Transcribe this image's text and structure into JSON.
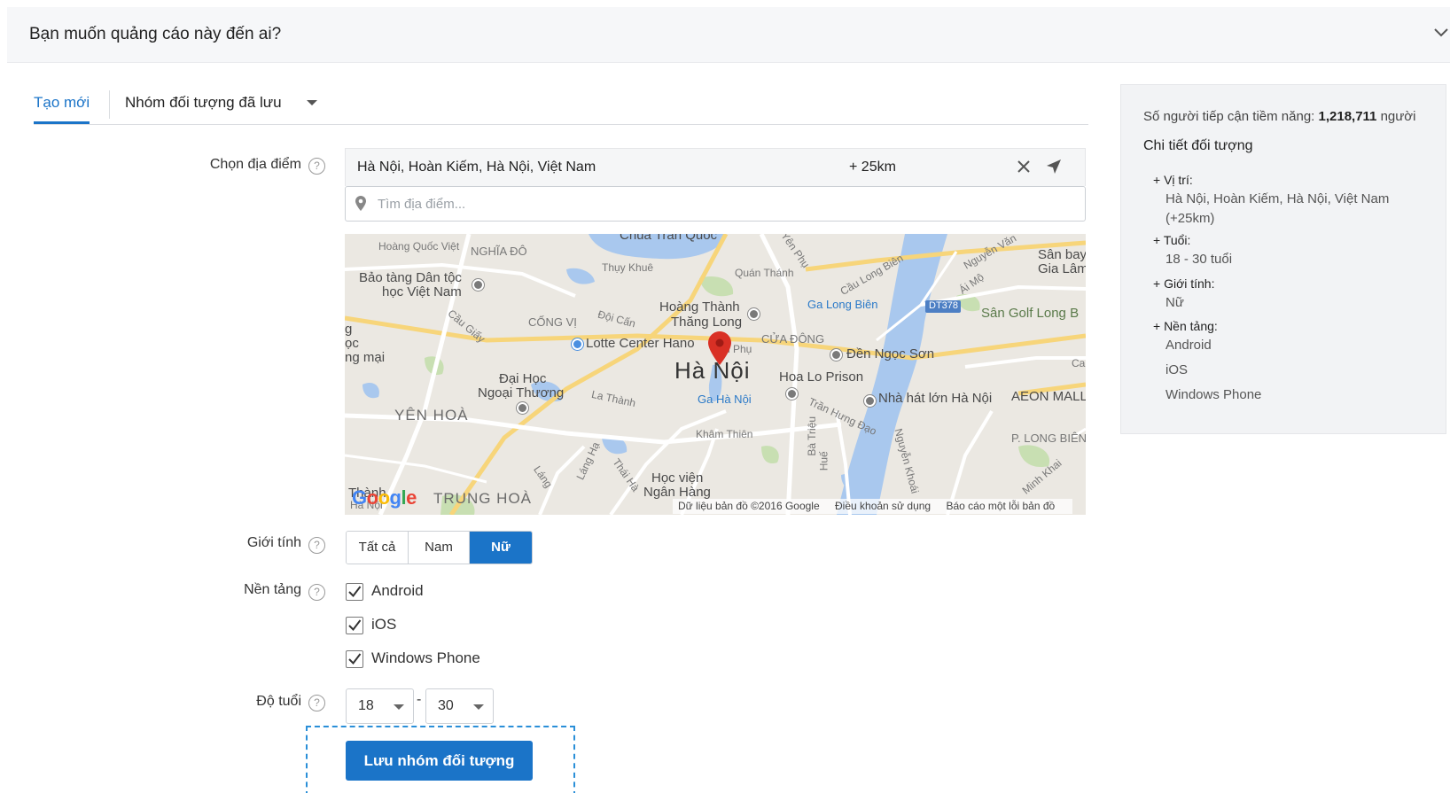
{
  "header": {
    "title": "Bạn muốn quảng cáo này đến ai?"
  },
  "tabs": [
    {
      "label": "Tạo mới"
    },
    {
      "label": "Nhóm đối tượng đã lưu"
    }
  ],
  "form": {
    "location_label": "Chọn địa điểm",
    "gender_label": "Giới tính",
    "platform_label": "Nền tảng",
    "age_label": "Độ tuổi",
    "help_glyph": "?"
  },
  "location": {
    "selected": "Hà Nội, Hoàn Kiếm, Hà Nội, Việt Nam",
    "radius": "+ 25km",
    "search_placeholder": "Tìm địa điểm..."
  },
  "map": {
    "labels": {
      "hoang_quoc_viet": "Hoàng Quốc Việt",
      "nghia_do": "NGHĨA ĐÔ",
      "chua_tran_quoc": "Chùa Trấn Quốc",
      "yen_phu": "Yên Phụ",
      "thuy_khue": "Thụy Khuê",
      "quan_thanh": "Quán Thánh",
      "cau_long_bien": "Cầu Long Biên",
      "nguyen_van": "Nguyễn Văn",
      "san_bay": "Sân bay",
      "gia_lam": "Gia Lâm",
      "bao_tang_1": "Bảo tàng Dân tộc",
      "bao_tang_2": "học Việt Nam",
      "hoang_thanh_1": "Hoàng Thành",
      "hoang_thanh_2": "Thăng Long",
      "ga_long_bien": "Ga Long Biên",
      "road_dt378": "DT378",
      "san_golf": "Sân Golf Long B",
      "cau_giay": "Cầu Giấy",
      "cong_vi": "CỐNG VỊ",
      "doi_can": "Đội Cấn",
      "lotte": "Lotte Center Hano",
      "cua_dong": "CỬA ĐÔNG",
      "den_ngoc_son": "Đền Ngọc Sơn",
      "ha_noi": "Hà Nội",
      "hoa_lo": "Hoa Lo Prison",
      "dai_hoc_1": "Đại Học",
      "dai_hoc_2": "Ngoại Thương",
      "la_thanh": "La Thành",
      "ga_ha_noi": "Ga Hà Nội",
      "nha_hat": "Nhà hát lớn Hà Nội",
      "aeon": "AEON MALL",
      "yen_hoa": "YÊN HOÀ",
      "kham_thien": "Khâm Thiên",
      "tran_hung_dao": "Trần Hưng Đạo",
      "p_long_bien": "P. LONG BIÊN",
      "hoc_vien_1": "Học viện",
      "hoc_vien_2": "Ngân Hàng",
      "trung_hoa": "TRUNG HOÀ",
      "thanh_1": "Thành",
      "thanh_2": "Hà Nội",
      "lang_ha": "Láng Hạ",
      "thai_ha": "Thái Hà",
      "ba_trieu": "Bà Triệu",
      "hue": "Huế",
      "nguyen_khoai": "Nguyễn Khoái",
      "minh_khai": "Minh Khai",
      "ai_mo": "Ái Mộ",
      "edge_g": "g",
      "edge_oc": "ọc",
      "edge_mai": "ng mại",
      "edge_ca": "Ca",
      "lang": "Láng",
      "hang_phu": "n Phụ",
      "google_logo": "Google"
    },
    "footer": {
      "data": "Dữ liệu bản đồ ©2016 Google",
      "terms": "Điều khoản sử dụng",
      "report": "Báo cáo một lỗi bản đồ"
    },
    "marker_color": "#d93025"
  },
  "gender": {
    "options": [
      {
        "label": "Tất cả",
        "selected": false
      },
      {
        "label": "Nam",
        "selected": false
      },
      {
        "label": "Nữ",
        "selected": true
      }
    ]
  },
  "platforms": [
    {
      "label": "Android",
      "checked": true
    },
    {
      "label": "iOS",
      "checked": true
    },
    {
      "label": "Windows Phone",
      "checked": true
    }
  ],
  "age": {
    "min": "18",
    "max": "30",
    "separator": "-"
  },
  "save_button": "Lưu nhóm đối tượng",
  "panel": {
    "reach_prefix": "Số người tiếp cận tiềm năng:",
    "reach_value": "1,218,711",
    "reach_suffix": "người",
    "detail_title": "Chi tiết đối tượng",
    "location_title": "+ Vị trí:",
    "location_value": "Hà Nội, Hoàn Kiếm, Hà Nội, Việt Nam",
    "location_radius": "(+25km)",
    "age_title": "+ Tuổi:",
    "age_value": "18 - 30 tuổi",
    "gender_title": "+ Giới tính:",
    "gender_value": "Nữ",
    "platform_title": "+ Nền tảng:",
    "platform_values": [
      "Android",
      "iOS",
      "Windows Phone"
    ]
  },
  "colors": {
    "accent": "#1b74c8",
    "dashed_outline": "#2a8fd8",
    "panel_bg": "#f2f3f5"
  }
}
